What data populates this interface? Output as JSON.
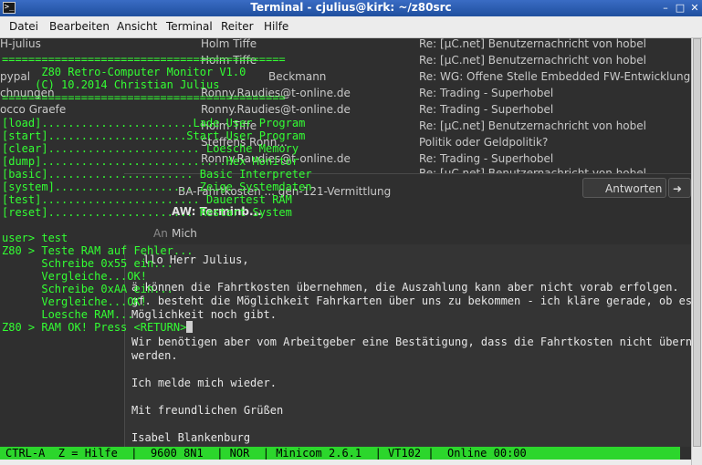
{
  "window": {
    "title": "Terminal - cjulius@kirk: ~/z80src",
    "icon_glyph": ">_",
    "minimize": "–",
    "maximize": "□",
    "close": "✕"
  },
  "menu": [
    "Datei",
    "Bearbeiten",
    "Ansicht",
    "Terminal",
    "Reiter",
    "Hilfe"
  ],
  "background": {
    "left_fragments": [
      "H-julius",
      "pypal",
      "chnungen",
      "occo Graefe"
    ],
    "senders": [
      "Holm Tiffe",
      "Holm Tiffe",
      "Beckmann",
      "Ronny.Raudies@t-online.de",
      "Ronny.Raudies@t-online.de",
      "Holm Tiffe",
      "Steffens Ronn...",
      "Ronny.Raudies@t-online.de"
    ],
    "subjects": [
      "Re: [µC.net] Benutzernachricht von hobel",
      "Re: [µC.net] Benutzernachricht von hobel",
      "Re: WG: Offene Stelle Embedded FW-Entwicklung",
      "Re: Trading - Superhobel",
      "Re: Trading - Superhobel",
      "Re: [µC.net] Benutzernachricht von hobel",
      "Politik oder Geldpolitik?",
      "Re: Trading - Superhobel",
      "Re: [µC.net] Benutzernachricht von hobel"
    ],
    "message_subject": "BA-Fahrtkosten ... gen-121-Vermittlung",
    "reply_button": "Antworten",
    "reply_label": "AW: Terminb...",
    "to_label": "An",
    "to_value": "Mich",
    "body_lines": [
      "llo Herr Julius,",
      "",
      "ä können die Fahrtkosten übernehmen, die Auszahlung kann aber nicht vorab erfolgen.",
      "gf. besteht die Möglichkeit Fahrkarten über uns zu bekommen - ich kläre gerade, ob es",
      "Möglichkeit noch gibt.",
      "",
      "Wir benötigen aber vom Arbeitgeber eine Bestätigung, dass die Fahrtkosten nicht übernom",
      "werden.",
      "",
      "Ich melde mich wieder.",
      "",
      "Mit freundlichen Grüßen",
      "",
      "Isabel Blankenburg"
    ]
  },
  "terminal": {
    "lines": [
      "===========================================",
      "      Z80 Retro-Computer Monitor V1.0",
      "     (C) 10.2014 Christian Julius",
      "===========================================",
      "[load].......................Lade User Program",
      "[start].....................Start User Program",
      "[clear]....................... Loesche Memory",
      "[dump]............................Hex Monitor",
      "[basic]...................... Basic Interpreter",
      "[system]..................... Zeige Systemdaten",
      "[test]........................ Dauertest RAM",
      "[reset]...................... Restart System",
      "",
      "user> test",
      "Z80 > Teste RAM auf Fehler...",
      "      Schreibe 0x55 ein...",
      "      Vergleiche...OK!",
      "      Schreibe 0xAA ein...",
      "      Vergleiche...OK!",
      "      Loesche RAM...",
      "Z80 > RAM OK! Press <RETURN>"
    ]
  },
  "status": "CTRL-A  Z = Hilfe  |  9600 8N1  | NOR  | Minicom 2.6.1  | VT102 |  Online 00:00"
}
